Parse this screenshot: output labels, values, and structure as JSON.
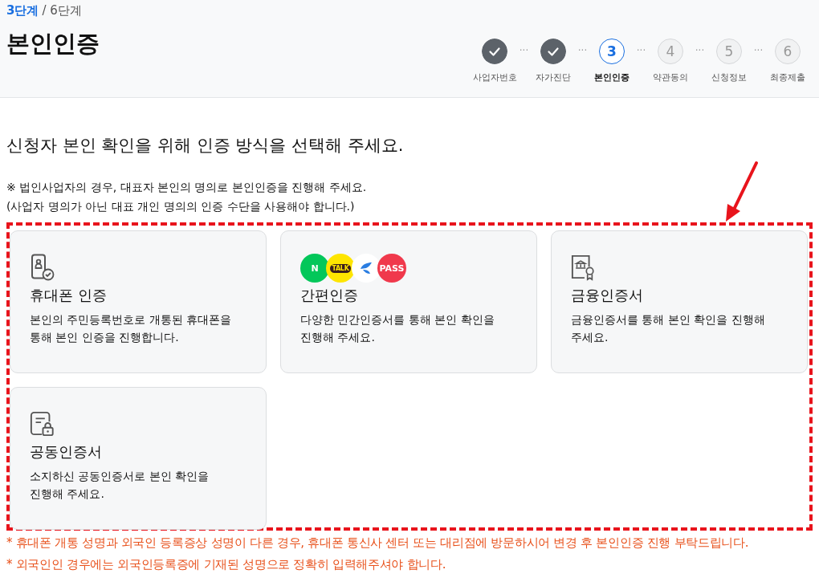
{
  "step_indicator": {
    "current": "3단계",
    "total": "/ 6단계"
  },
  "title": "본인인증",
  "steps": [
    {
      "completed": true,
      "selected": false,
      "label": "사업자번호"
    },
    {
      "connector": "···",
      "completed": true,
      "selected": false,
      "label": "자가진단"
    },
    {
      "connector": "···",
      "number": "3",
      "completed": false,
      "selected": true,
      "label": "본인인증"
    },
    {
      "connector": "···",
      "number": "4",
      "completed": false,
      "selected": false,
      "label": "약관동의"
    },
    {
      "connector": "···",
      "number": "5",
      "completed": false,
      "selected": false,
      "label": "신청정보"
    },
    {
      "connector": "···",
      "number": "6",
      "completed": false,
      "selected": false,
      "label": "최종제출"
    }
  ],
  "heading": "신청자 본인 확인을 위해 인증 방식을 선택해 주세요.",
  "notes": [
    "※ 법인사업자의 경우, 대표자 본인의 명의로 본인인증을 진행해 주세요.",
    "(사업자 명의가 아닌 대표 개인 명의의 인증 수단을 사용해야 합니다.)"
  ],
  "methods": [
    {
      "kind": "phone",
      "title": "휴대폰 인증",
      "description": "본인의 주민등록번호로 개통된 휴대폰을 통해 본인 인증을 진행합니다."
    },
    {
      "kind": "simple",
      "title": "간편인증",
      "description": "다양한 민간인증서를 통해 본인 확인을 진행해 주세요.",
      "logos": [
        {
          "label": "N",
          "color": "#03c75a"
        },
        {
          "label": "TALK",
          "color": "#fee500"
        },
        {
          "color": "#ffffff"
        },
        {
          "label": "PASS",
          "color": "#f0394c"
        }
      ]
    },
    {
      "kind": "bank",
      "title": "금융인증서",
      "description": "금융인증서를 통해 본인 확인을 진행해 주세요."
    },
    {
      "kind": "joint",
      "title": "공동인증서",
      "description": "소지하신 공동인증서로 본인 확인을 진행해 주세요."
    }
  ],
  "footnotes": [
    "* 휴대폰 개통 성명과 외국인 등록증상 성명이 다른 경우, 휴대폰 통신사 센터 또는 대리점에 방문하시어 변경 후 본인인증 진행 부탁드립니다.",
    "* 외국인인 경우에는 외국인등록증에 기재된 성명으로 정확히 입력해주셔야 합니다."
  ]
}
